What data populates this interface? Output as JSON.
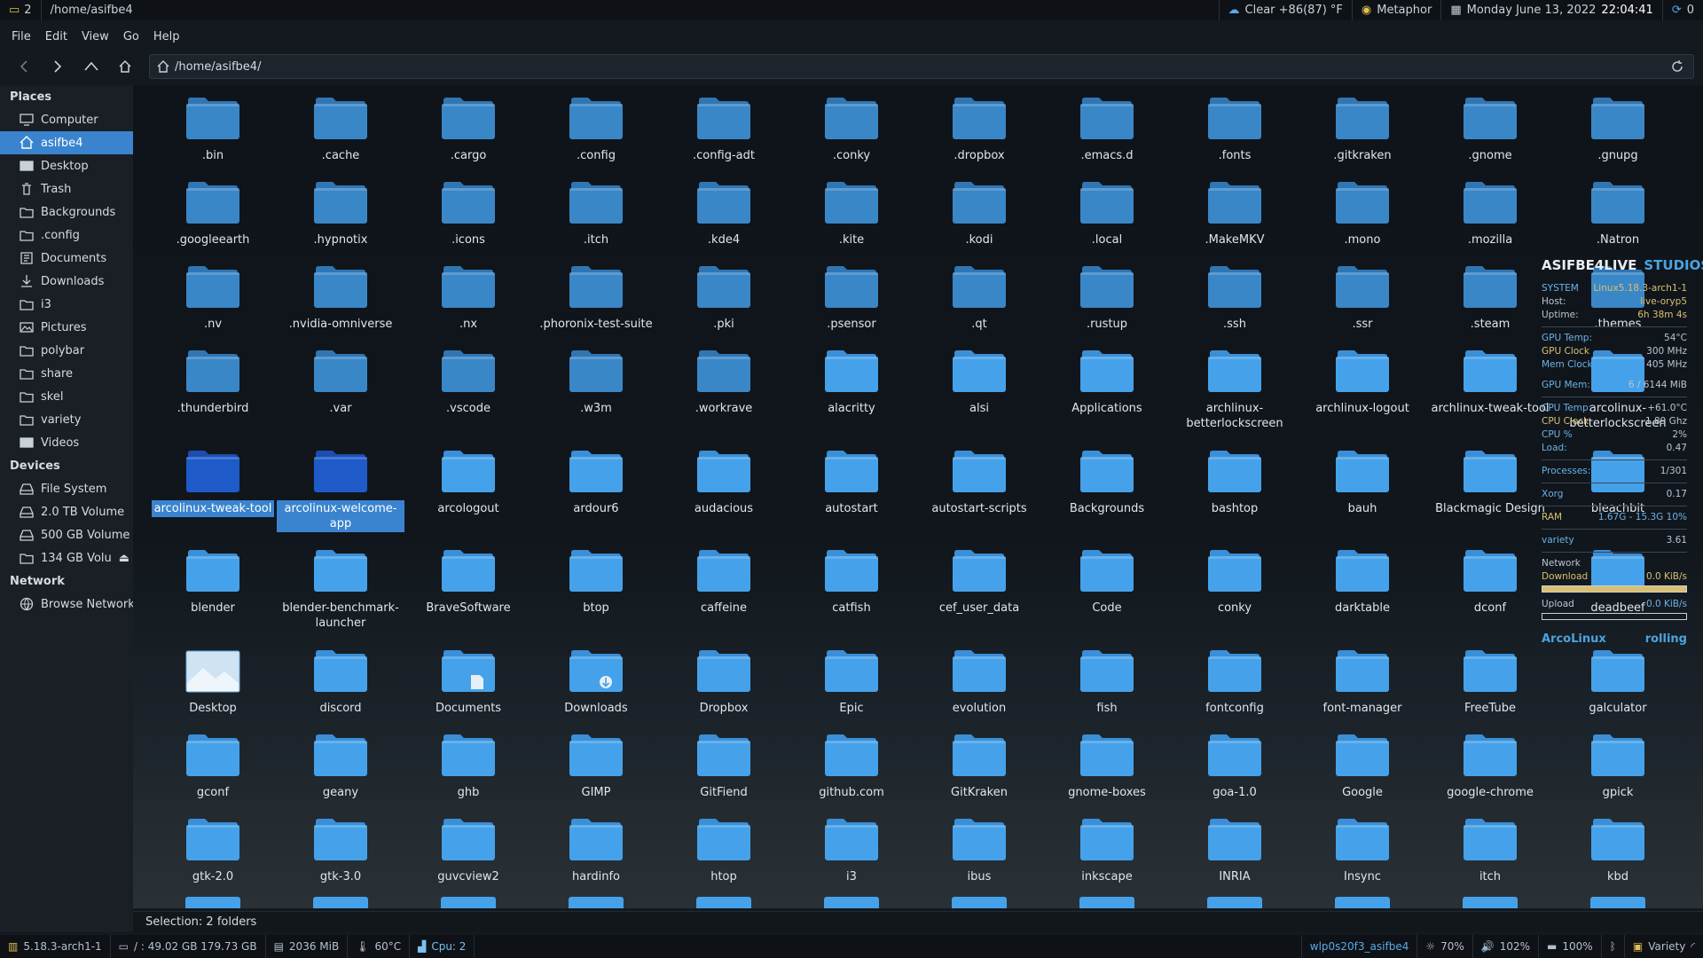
{
  "topbar": {
    "workspace": "2",
    "window_title": "/home/asifbe4",
    "weather": "Clear +86(87) °F",
    "theme": "Metaphor",
    "date": "Monday June 13, 2022",
    "time": "22:04:41",
    "updates": "0"
  },
  "menubar": {
    "items": [
      "File",
      "Edit",
      "View",
      "Go",
      "Help"
    ]
  },
  "toolbar": {
    "path": "/home/asifbe4/"
  },
  "sidebar": {
    "places_title": "Places",
    "places": [
      "Computer",
      "asifbe4",
      "Desktop",
      "Trash",
      "Backgrounds",
      ".config",
      "Documents",
      "Downloads",
      "i3",
      "Pictures",
      "polybar",
      "share",
      "skel",
      "variety",
      "Videos"
    ],
    "devices_title": "Devices",
    "devices": [
      "File System",
      "2.0 TB Volume",
      "500 GB Volume",
      "134 GB Volu..."
    ],
    "network_title": "Network",
    "network": [
      "Browse Network"
    ]
  },
  "files": [
    ".bin",
    ".cache",
    ".cargo",
    ".config",
    ".config-adt",
    ".conky",
    ".dropbox",
    ".emacs.d",
    ".fonts",
    ".gitkraken",
    ".gnome",
    ".gnupg",
    ".googleearth",
    ".hypnotix",
    ".icons",
    ".itch",
    ".kde4",
    ".kite",
    ".kodi",
    ".local",
    ".MakeMKV",
    ".mono",
    ".mozilla",
    ".Natron",
    ".nv",
    ".nvidia-omniverse",
    ".nx",
    ".phoronix-test-suite",
    ".pki",
    ".psensor",
    ".qt",
    ".rustup",
    ".ssh",
    ".ssr",
    ".steam",
    ".themes",
    ".thunderbird",
    ".var",
    ".vscode",
    ".w3m",
    ".workrave",
    "alacritty",
    "alsi",
    "Applications",
    "archlinux-betterlockscreen",
    "archlinux-logout",
    "archlinux-tweak-tool",
    "arcolinux-betterlockscreen",
    "arcolinux-tweak-tool",
    "arcolinux-welcome-app",
    "arcologout",
    "ardour6",
    "audacious",
    "autostart",
    "autostart-scripts",
    "Backgrounds",
    "bashtop",
    "bauh",
    "Blackmagic Design",
    "bleachbit",
    "blender",
    "blender-benchmark-launcher",
    "BraveSoftware",
    "btop",
    "caffeine",
    "catfish",
    "cef_user_data",
    "Code",
    "conky",
    "darktable",
    "dconf",
    "deadbeef",
    "Desktop",
    "discord",
    "Documents",
    "Downloads",
    "Dropbox",
    "Epic",
    "evolution",
    "fish",
    "fontconfig",
    "font-manager",
    "FreeTube",
    "galculator",
    "gconf",
    "geany",
    "ghb",
    "GIMP",
    "GitFiend",
    "github.com",
    "GitKraken",
    "gnome-boxes",
    "goa-1.0",
    "Google",
    "google-chrome",
    "gpick",
    "gtk-2.0",
    "gtk-3.0",
    "guvcview2",
    "hardinfo",
    "htop",
    "i3",
    "ibus",
    "inkscape",
    "INRIA",
    "Insync",
    "itch",
    "kbd"
  ],
  "selected_files": [
    "arcolinux-tweak-tool",
    "arcolinux-welcome-app"
  ],
  "conky": {
    "title_a": "ASIFBE4LIVE",
    "title_b": "STUDIOS",
    "system_label": "SYSTEM",
    "kernel": "Linux5.18.3-arch1-1",
    "host_label": "Host:",
    "host": "live-oryp5",
    "uptime_label": "Uptime:",
    "uptime": "6h 38m 4s",
    "gpu_temp_label": "GPU Temp:",
    "gpu_temp": "54°C",
    "gpu_clock_label": "GPU Clock",
    "gpu_clock": "300 MHz",
    "mem_clock_label": "Mem Clock",
    "mem_clock": "405 MHz",
    "gpu_mem_label": "GPU Mem:",
    "gpu_mem": "6 / 6144 MiB",
    "cpu_temp_label": "CPU Temp:",
    "cpu_temp": "+61.0°C",
    "cpu_clock_label": "CPU Clock",
    "cpu_clock": "1.89 Ghz",
    "cpu_pct_label": "CPU %",
    "cpu_pct": "2%",
    "load_label": "Load:",
    "load": "0.47",
    "processes_label": "Processes:",
    "processes": "1/301",
    "xorg_label": "Xorg",
    "xorg": "0.17",
    "ram_label": "RAM",
    "ram": "1.67G - 15.3G 10%",
    "variety_label": "variety",
    "variety": "3.61",
    "network_label": "Network",
    "download_label": "Download",
    "download": "0.0 KiB/s",
    "download_level": 1.0,
    "upload_label": "Upload",
    "upload": "0.0 KiB/s",
    "upload_level": 0.0,
    "footer_a": "ArcoLinux",
    "footer_b": "rolling"
  },
  "status": {
    "selection": "Selection: 2 folders"
  },
  "bottombar": {
    "kernel": "5.18.3-arch1-1",
    "disk": "/ : 49.02 GB  179.73 GB",
    "mem": "2036 MiB",
    "temp": "60°C",
    "cpu": "Cpu: 2",
    "network": "wlp0s20f3_asifbe4",
    "brightness": "70%",
    "volume": "102%",
    "battery": "100%",
    "wallpaper": "Variety"
  },
  "colors": {
    "accent": "#3a84cf",
    "folder": "#45a0e8",
    "folder_dark": "#3a8fd8"
  }
}
